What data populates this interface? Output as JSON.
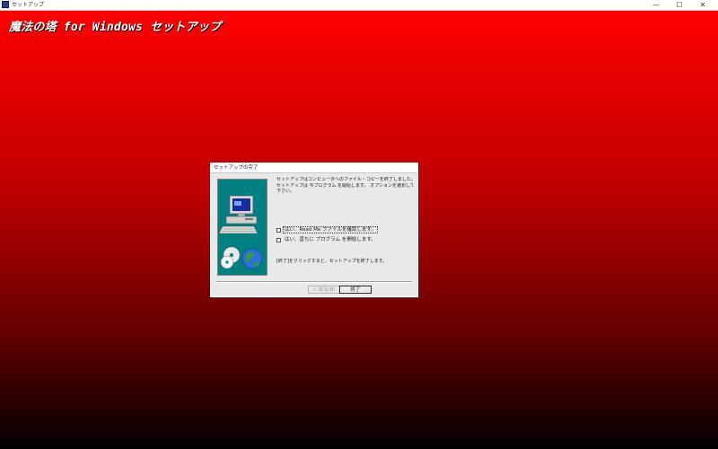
{
  "window": {
    "title": "セットアップ",
    "controls": {
      "minimize": "—",
      "maximize": "☐",
      "close": "✕"
    }
  },
  "banner": {
    "text": "魔法の塔 for Windows セットアップ"
  },
  "dialog": {
    "title": "セットアップの完了",
    "message_lines": [
      "セットアップはコンピュータへのファイル・コピーを終了しました。",
      "セットアップは 今プログラム を開始します。 オプションを選択して",
      "下さい。"
    ],
    "options": [
      {
        "label": "はい、Read Me ファイルを確認します。",
        "checked": false
      },
      {
        "label": "はい、直ちに プログラム を開始します。",
        "checked": false
      }
    ],
    "finish_message": "[終了]をクリックすると、セットアップを終了します。",
    "buttons": {
      "back": "< 戻る(B)",
      "finish": "終了"
    }
  },
  "colors": {
    "desktop_top": "#ff0000",
    "desktop_bottom": "#000000",
    "dialog_bg": "#e9e9e9",
    "illustration_bg": "#008080"
  },
  "icons": {
    "app": "setup-app-icon",
    "illustration": "computer-cd-globe-illustration"
  }
}
